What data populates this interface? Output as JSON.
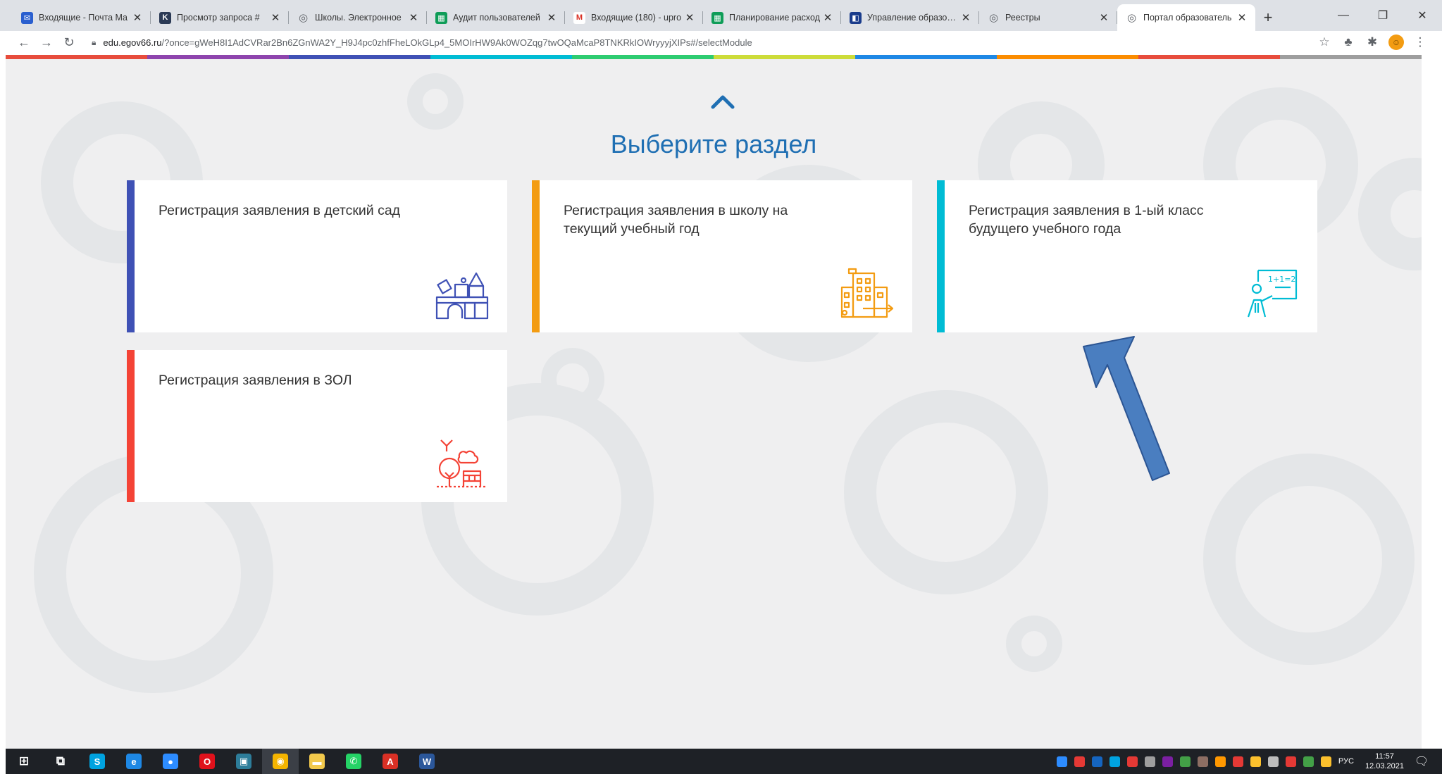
{
  "browser": {
    "tabs": [
      {
        "title": "Входящие - Почта Ma",
        "icon": "mail-icon",
        "color": "#2a5fcf",
        "glyph": "✉"
      },
      {
        "title": "Просмотр запроса #",
        "icon": "k-icon",
        "color": "#2b3a55",
        "glyph": "K"
      },
      {
        "title": "Школы. Электронное",
        "icon": "globe-icon",
        "color": "#5f6368",
        "glyph": "◎"
      },
      {
        "title": "Аудит пользователей",
        "icon": "sheets-icon",
        "color": "#0f9d58",
        "glyph": "▦"
      },
      {
        "title": "Входящие (180) - upro",
        "icon": "gmail-icon",
        "color": "#ffffff",
        "glyph": "M"
      },
      {
        "title": "Планирование расход",
        "icon": "sheets-icon",
        "color": "#0f9d58",
        "glyph": "▦"
      },
      {
        "title": "Управление образован",
        "icon": "flag-icon",
        "color": "#1a3c8c",
        "glyph": "◧"
      },
      {
        "title": "Реестры",
        "icon": "globe-icon",
        "color": "#5f6368",
        "glyph": "◎"
      },
      {
        "title": "Портал образователь",
        "icon": "globe-icon",
        "color": "#5f6368",
        "glyph": "◎",
        "active": true
      }
    ],
    "close_glyph": "✕",
    "new_tab_glyph": "+",
    "win_min": "—",
    "win_max": "❐",
    "win_close": "✕",
    "url_domain": "edu.egov66.ru",
    "url_rest": "/?once=gWeH8I1AdCVRar2Bn6ZGnWA2Y_H9J4pc0zhfFheLOkGLp4_5MOIrHW9Ak0WOZqg7twOQaMcaP8TNKRkIOWryyyjXIPs#/selectModule",
    "rainbow_colors": [
      "#e74c3c",
      "#8e44ad",
      "#3f51b5",
      "#00bcd4",
      "#2ecc71",
      "#cddc39",
      "#1e88e5",
      "#fb8c00",
      "#e74c3c",
      "#9e9e9e"
    ]
  },
  "page": {
    "title": "Выберите раздел",
    "accent": "#1f6fb3",
    "cards": [
      {
        "title": "Регистрация заявления в детский сад",
        "color": "#3f51b5",
        "icon": "toy-blocks-icon"
      },
      {
        "title": "Регистрация заявления в школу на текущий учебный год",
        "color": "#f39c12",
        "icon": "school-building-icon"
      },
      {
        "title": "Регистрация заявления в 1-ый класс будущего учебного года",
        "color": "#00bcd4",
        "icon": "teacher-board-icon",
        "board_text": "1+1=2"
      },
      {
        "title": "Регистрация заявления в ЗОЛ",
        "color": "#f44336",
        "icon": "summer-camp-icon"
      }
    ],
    "arrow_color": "#4a7ec0"
  },
  "taskbar": {
    "apps": [
      {
        "name": "start-icon",
        "color": "transparent",
        "glyph": "⊞"
      },
      {
        "name": "task-view-icon",
        "color": "transparent",
        "glyph": "⧉"
      },
      {
        "name": "skype-icon",
        "color": "#00a3e0",
        "glyph": "S"
      },
      {
        "name": "edge-icon",
        "color": "#1e88e5",
        "glyph": "e"
      },
      {
        "name": "zoom-icon",
        "color": "#2d8cff",
        "glyph": "●"
      },
      {
        "name": "opera-icon",
        "color": "#e0111b",
        "glyph": "O"
      },
      {
        "name": "remote-desktop-icon",
        "color": "#2d7d9a",
        "glyph": "▣"
      },
      {
        "name": "chrome-icon",
        "color": "#f4b400",
        "glyph": "◉",
        "active": true
      },
      {
        "name": "explorer-icon",
        "color": "#f2c94c",
        "glyph": "▬"
      },
      {
        "name": "whatsapp-icon",
        "color": "#25d366",
        "glyph": "✆"
      },
      {
        "name": "acrobat-icon",
        "color": "#d93025",
        "glyph": "A"
      },
      {
        "name": "word-icon",
        "color": "#2b579a",
        "glyph": "W"
      }
    ],
    "tray_colors": [
      "#2d8cff",
      "#e53935",
      "#1565c0",
      "#00a3e0",
      "#e53935",
      "#9e9e9e",
      "#7b1fa2",
      "#43a047",
      "#8d6e63",
      "#ff9800",
      "#e53935",
      "#fbc02d",
      "#bdbdbd",
      "#e53935",
      "#43a047",
      "#fbc02d"
    ],
    "lang": "РУС",
    "time": "11:57",
    "date": "12.03.2021"
  }
}
